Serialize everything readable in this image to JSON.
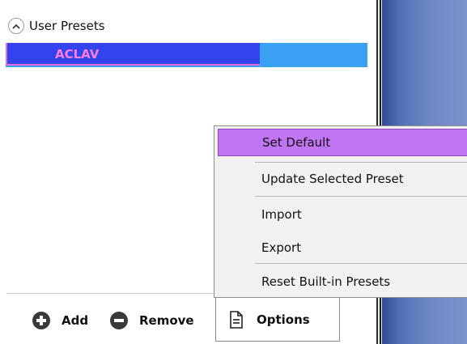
{
  "presets": {
    "group_label": "User Presets",
    "items": [
      {
        "label": "ACLAV",
        "selected": true
      }
    ]
  },
  "toolbar": {
    "add_label": "Add",
    "remove_label": "Remove",
    "options_label": "Options"
  },
  "options_menu": {
    "items": [
      {
        "label": "Set Default",
        "highlighted": true
      },
      {
        "label": "Update Selected Preset"
      },
      {
        "label": "Import"
      },
      {
        "label": "Export"
      },
      {
        "label": "Reset Built-in Presets"
      }
    ]
  },
  "icons": {
    "collapse": "chevron-up-icon",
    "add": "plus-circle-icon",
    "remove": "minus-circle-icon",
    "options": "document-icon"
  },
  "colors": {
    "selection_blue": "#3344ee",
    "row_light_blue": "#38a1f2",
    "preset_text": "#ff7be0",
    "menu_highlight": "#c174f4"
  }
}
